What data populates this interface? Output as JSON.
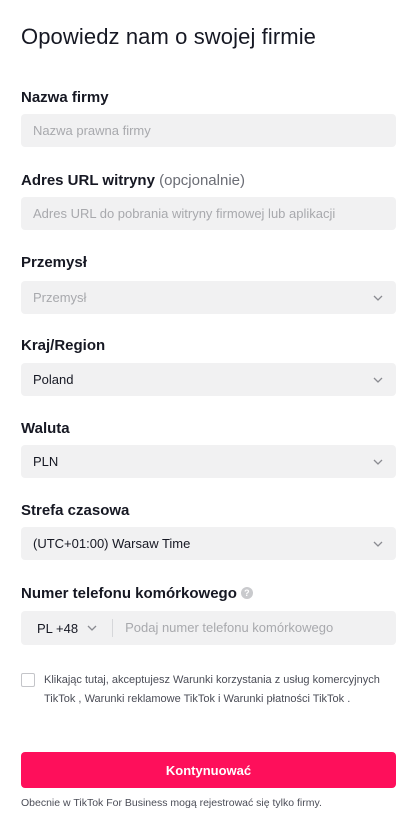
{
  "header": {
    "title": "Opowiedz nam o swojej firmie"
  },
  "form": {
    "company_name": {
      "label": "Nazwa firmy",
      "placeholder": "Nazwa prawna firmy",
      "value": ""
    },
    "website": {
      "label": "Adres URL witryny",
      "optional": "(opcjonalnie)",
      "placeholder": "Adres URL do pobrania witryny firmowej lub aplikacji",
      "value": ""
    },
    "industry": {
      "label": "Przemysł",
      "placeholder": "Przemysł"
    },
    "country": {
      "label": "Kraj/Region",
      "value": "Poland"
    },
    "currency": {
      "label": "Waluta",
      "value": "PLN"
    },
    "timezone": {
      "label": "Strefa czasowa",
      "value": "(UTC+01:00) Warsaw Time"
    },
    "phone": {
      "label": "Numer telefonu komórkowego",
      "help_icon": "?",
      "country_code": "PL +48",
      "placeholder": "Podaj numer telefonu komórkowego",
      "value": ""
    }
  },
  "consent": {
    "prefix": "Klikając tutaj, akceptujesz",
    "link1": "Warunki korzystania z usług komercyjnych TikTok",
    "sep1": " ,",
    "link2": "Warunki reklamowe TikTok",
    "sep2": " i",
    "link3": "Warunki płatności TikTok",
    "suffix": " ."
  },
  "actions": {
    "continue_label": "Kontynuować"
  },
  "footnote": "Obecnie w TikTok For Business mogą rejestrować się tylko firmy.",
  "colors": {
    "primary": "#fe0f5b",
    "field_bg": "#f1f1f2",
    "text": "#161823",
    "placeholder": "#a8a9ad"
  }
}
